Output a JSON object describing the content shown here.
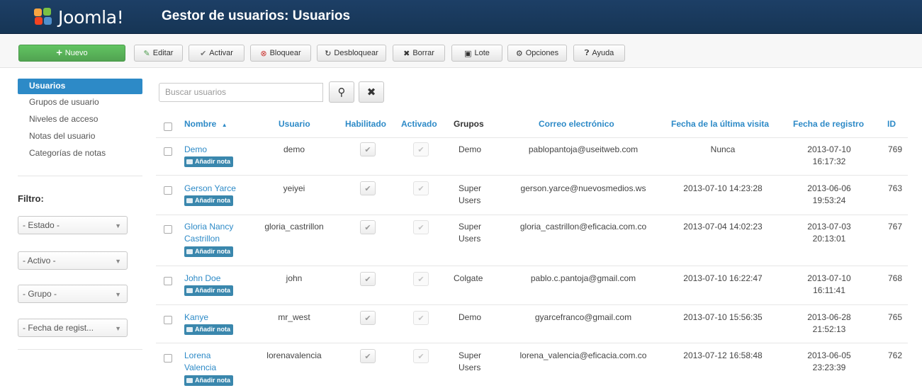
{
  "header": {
    "logo_text": "Joomla!",
    "title": "Gestor de usuarios: Usuarios"
  },
  "toolbar": {
    "new_label": "Nuevo",
    "edit_label": "Editar",
    "activate_label": "Activar",
    "block_label": "Bloquear",
    "unblock_label": "Desbloquear",
    "delete_label": "Borrar",
    "batch_label": "Lote",
    "options_label": "Opciones",
    "help_label": "Ayuda"
  },
  "sidebar": {
    "items": [
      {
        "label": "Usuarios",
        "active": true
      },
      {
        "label": "Grupos de usuario"
      },
      {
        "label": "Niveles de acceso"
      },
      {
        "label": "Notas del usuario"
      },
      {
        "label": "Categorías de notas"
      }
    ],
    "filter_label": "Filtro:",
    "filters": [
      "- Estado -",
      "- Activo -",
      "- Grupo -",
      "- Fecha de regist..."
    ]
  },
  "search": {
    "placeholder": "Buscar usuarios"
  },
  "table": {
    "headers": {
      "name": "Nombre",
      "sort_indicator": "▲",
      "user": "Usuario",
      "enabled": "Habilitado",
      "activated": "Activado",
      "groups": "Grupos",
      "email": "Correo electrónico",
      "last_visit": "Fecha de la última visita",
      "register": "Fecha de registro",
      "id": "ID"
    },
    "note_label": "Añadir nota",
    "rows": [
      {
        "name": "Demo",
        "user": "demo",
        "groups": "Demo",
        "email": "pablopantoja@useitweb.com",
        "last_visit": "Nunca",
        "reg_date": "2013-07-10",
        "reg_time": "16:17:32",
        "id": "769"
      },
      {
        "name": "Gerson Yarce",
        "user": "yeiyei",
        "groups": "Super Users",
        "email": "gerson.yarce@nuevosmedios.ws",
        "last_visit": "2013-07-10 14:23:28",
        "reg_date": "2013-06-06",
        "reg_time": "19:53:24",
        "id": "763"
      },
      {
        "name": "Gloria Nancy Castrillon",
        "user": "gloria_castrillon",
        "groups": "Super Users",
        "email": "gloria_castrillon@eficacia.com.co",
        "last_visit": "2013-07-04 14:02:23",
        "reg_date": "2013-07-03",
        "reg_time": "20:13:01",
        "id": "767"
      },
      {
        "name": "John Doe",
        "user": "john",
        "groups": "Colgate",
        "email": "pablo.c.pantoja@gmail.com",
        "last_visit": "2013-07-10 16:22:47",
        "reg_date": "2013-07-10",
        "reg_time": "16:11:41",
        "id": "768"
      },
      {
        "name": "Kanye",
        "user": "mr_west",
        "groups": "Demo",
        "email": "gyarcefranco@gmail.com",
        "last_visit": "2013-07-10 15:56:35",
        "reg_date": "2013-06-28",
        "reg_time": "21:52:13",
        "id": "765"
      },
      {
        "name": "Lorena Valencia",
        "user": "lorenavalencia",
        "groups": "Super Users",
        "email": "lorena_valencia@eficacia.com.co",
        "last_visit": "2013-07-12 16:58:48",
        "reg_date": "2013-06-05",
        "reg_time": "23:23:39",
        "id": "762"
      }
    ]
  },
  "colors": {
    "header_bg": "#1d3f66",
    "accent_blue": "#2d8ac7",
    "new_button_green": "#51a351",
    "note_badge": "#3a87ad"
  },
  "icons": {
    "new": "plus-circle-icon",
    "edit": "edit-icon",
    "activate": "check-icon",
    "block": "block-icon",
    "unblock": "refresh-icon",
    "delete": "x-icon",
    "batch": "batch-icon",
    "options": "gear-icon",
    "help": "question-icon"
  }
}
